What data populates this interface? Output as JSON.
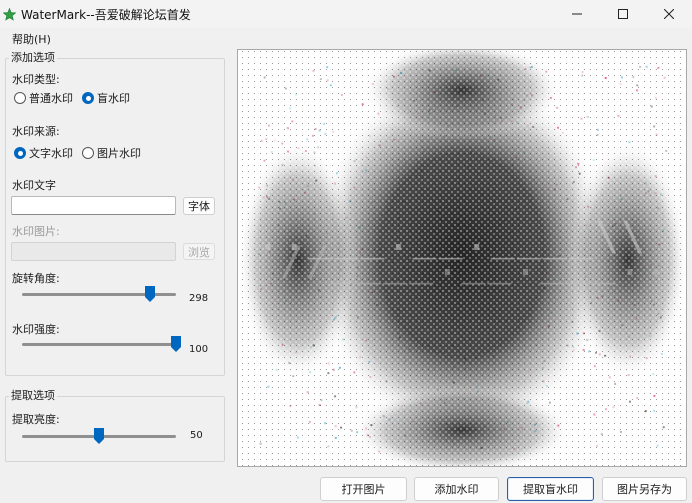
{
  "window": {
    "title": "WaterMark--吾爱破解论坛首发",
    "icon": "green-star-icon",
    "controls": [
      "minimize-icon",
      "maximize-icon",
      "close-icon"
    ]
  },
  "menu": {
    "help": "帮助(H)"
  },
  "add_options": {
    "group_title": "添加选项",
    "type_label": "水印类型:",
    "type_options": [
      {
        "label": "普通水印",
        "checked": false
      },
      {
        "label": "盲水印",
        "checked": true
      }
    ],
    "source_label": "水印来源:",
    "source_options": [
      {
        "label": "文字水印",
        "checked": true
      },
      {
        "label": "图片水印",
        "checked": false
      }
    ],
    "text_label": "水印文字",
    "text_value": "",
    "font_button": "字体",
    "image_label": "水印图片:",
    "image_value": "",
    "browse_button": "浏览",
    "rotation_label": "旋转角度:",
    "rotation_value": "298",
    "rotation_fraction": 0.83,
    "strength_label": "水印强度:",
    "strength_value": "100",
    "strength_fraction": 1.0
  },
  "extract_options": {
    "group_title": "提取选项",
    "brightness_label": "提取亮度:",
    "brightness_value": "50",
    "brightness_fraction": 0.5
  },
  "buttons": {
    "open_image": "打开图片",
    "add_watermark": "添加水印",
    "extract_blind": "提取盲水印",
    "save_as": "图片另存为"
  },
  "colors": {
    "accent": "#0067c0",
    "app_icon": "#2ea043"
  }
}
